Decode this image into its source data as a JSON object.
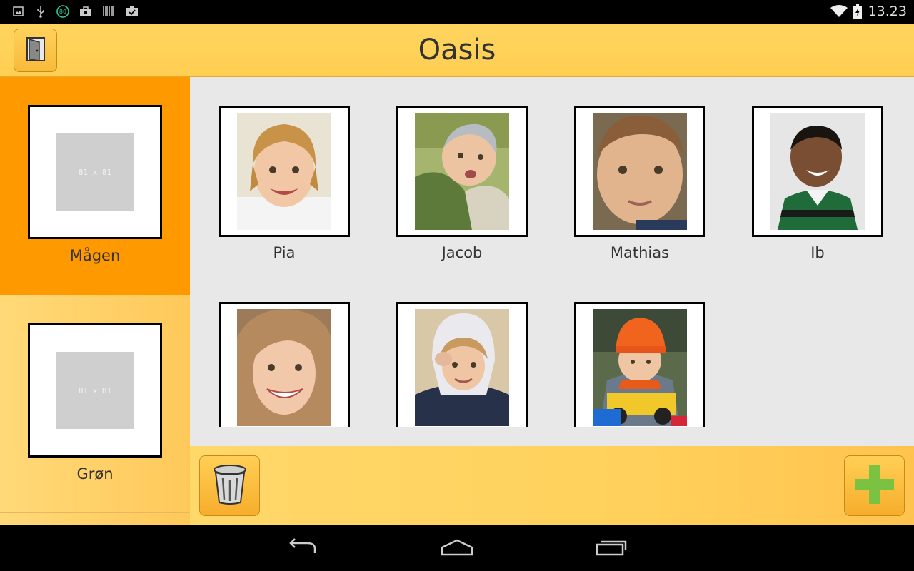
{
  "status_bar": {
    "time": "13.23",
    "battery_badge": "80",
    "icons": [
      "image-icon",
      "usb-icon",
      "battery-saver-icon",
      "briefcase-icon",
      "barcode-icon",
      "clipboard-check-icon",
      "wifi-icon",
      "battery-icon"
    ]
  },
  "header": {
    "title": "Oasis",
    "exit_icon": "door-icon"
  },
  "sidebar": {
    "departments": [
      {
        "label": "Mågen",
        "placeholder": "81 x 81",
        "selected": true
      },
      {
        "label": "Grøn",
        "placeholder": "81 x 81",
        "selected": false
      }
    ]
  },
  "main": {
    "children": [
      {
        "name": "Pia"
      },
      {
        "name": "Jacob"
      },
      {
        "name": "Mathias"
      },
      {
        "name": "Ib"
      },
      {
        "name": ""
      },
      {
        "name": ""
      },
      {
        "name": ""
      }
    ]
  },
  "toolbar": {
    "delete_icon": "trash-icon",
    "add_icon": "plus-icon"
  },
  "navbar": {
    "icons": [
      "back-icon",
      "home-icon",
      "recents-icon"
    ]
  },
  "colors": {
    "header": "#ffd45e",
    "selected_department": "#ff9900",
    "add_plus": "#7cc242"
  }
}
